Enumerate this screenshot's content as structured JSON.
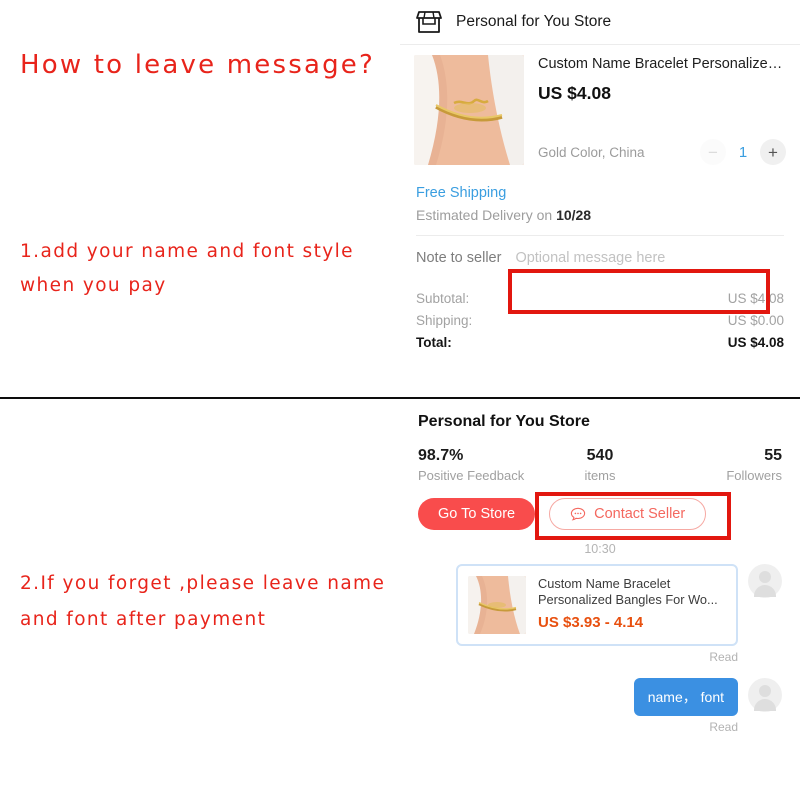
{
  "annotations": {
    "title": "How to leave message?",
    "step1_line1": "1.add your name and font style",
    "step1_line2": "when you pay",
    "step2_line1": "2.If you forget ,please leave name",
    "step2_line2": "and font after payment",
    "arrow_label": "name,font",
    "color": "#e8241b"
  },
  "checkout": {
    "store_icon": "shop-icon",
    "store_name": "Personal for You Store",
    "product": {
      "title": "Custom Name Bracelet Personalized B...",
      "price": "US $4.08",
      "variant": "Gold Color, China",
      "quantity": "1",
      "minus_label": "−",
      "plus_label": "+"
    },
    "shipping": {
      "free_label": "Free Shipping",
      "eta_prefix": "Estimated Delivery on ",
      "eta_date": "10/28"
    },
    "note": {
      "label": "Note to seller",
      "placeholder": "Optional message here",
      "value": ""
    },
    "totals": [
      {
        "label": "Subtotal:",
        "value": "US $4.08"
      },
      {
        "label": "Shipping:",
        "value": "US $0.00"
      },
      {
        "label": "Total:",
        "value": "US $4.08"
      }
    ]
  },
  "store_page": {
    "title": "Personal for You Store",
    "stats": [
      {
        "value": "98.7%",
        "label": "Positive Feedback"
      },
      {
        "value": "540",
        "label": "items"
      },
      {
        "value": "55",
        "label": "Followers"
      }
    ],
    "go_to_store_label": "Go To Store",
    "contact_seller_label": "Contact Seller",
    "accent": "#f94c4c"
  },
  "chat": {
    "timestamp": "10:30",
    "product_card": {
      "title": "Custom Name Bracelet Personalized Bangles For Wo...",
      "price": "US $3.93 - 4.14"
    },
    "read_label_1": "Read",
    "user_message": "name， font",
    "read_label_2": "Read",
    "bubble_color": "#3b90e2"
  }
}
